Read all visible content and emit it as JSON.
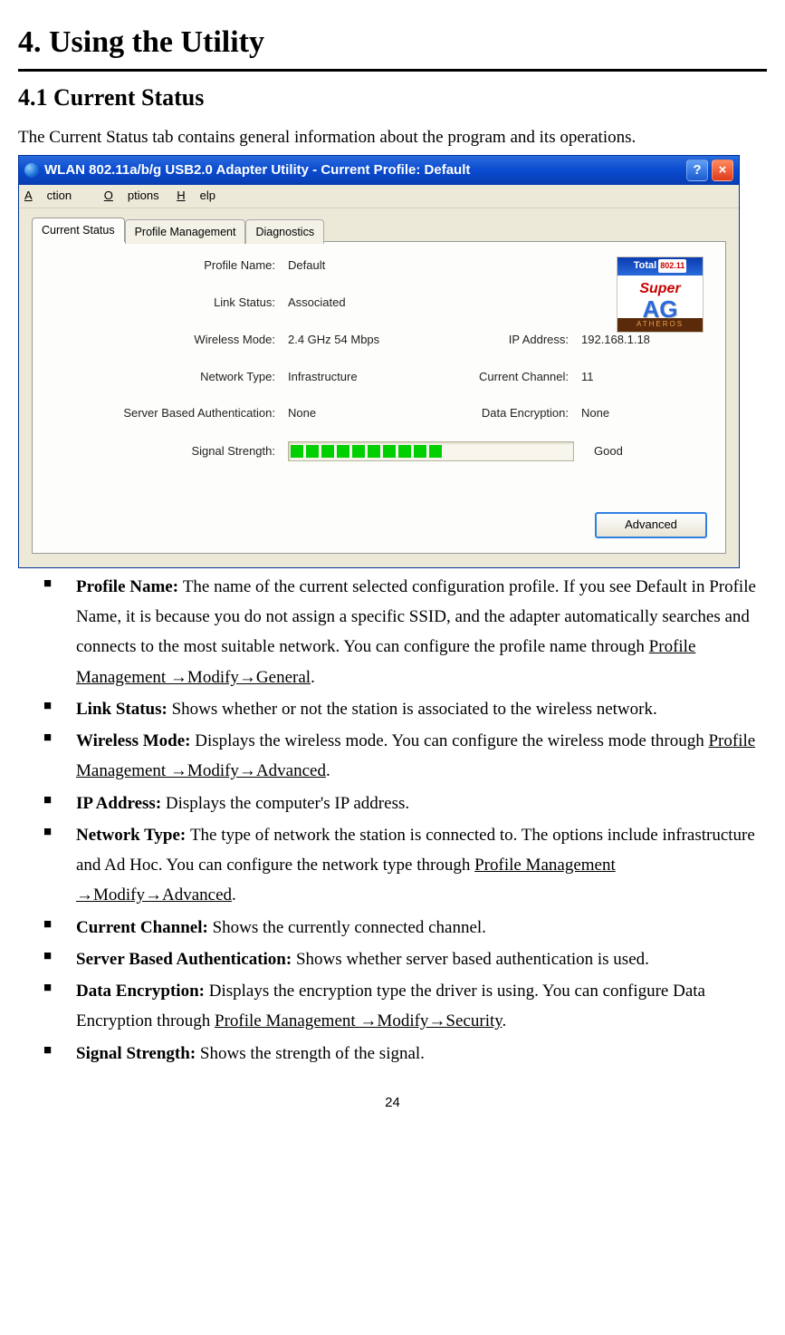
{
  "h1": "4. Using the Utility",
  "h2": "4.1 Current Status",
  "intro": "The Current Status tab contains general information about the program and its operations.",
  "window": {
    "title": "WLAN 802.11a/b/g USB2.0 Adapter Utility - Current Profile: Default",
    "help_btn": "?",
    "close_btn": "×",
    "menu": {
      "action": "Action",
      "options": "Options",
      "help": "Help"
    },
    "tabs": {
      "current": "Current Status",
      "profile": "Profile Management",
      "diag": "Diagnostics"
    },
    "logo": {
      "top1": "Total",
      "top2": "802.11",
      "mid": "Super",
      "ag": "AG",
      "bot": "ATHEROS"
    },
    "labels": {
      "profile_name": "Profile Name:",
      "link_status": "Link Status:",
      "wireless_mode": "Wireless Mode:",
      "ip_address": "IP Address:",
      "network_type": "Network Type:",
      "current_channel": "Current Channel:",
      "server_auth": "Server Based Authentication:",
      "data_encryption": "Data Encryption:",
      "signal_strength": "Signal Strength:"
    },
    "values": {
      "profile_name": "Default",
      "link_status": "Associated",
      "wireless_mode": "2.4 GHz 54 Mbps",
      "ip_address": "192.168.1.18",
      "network_type": "Infrastructure",
      "current_channel": "11",
      "server_auth": "None",
      "data_encryption": "None",
      "signal_strength_text": "Good"
    },
    "advanced_btn": "Advanced"
  },
  "bullets": {
    "b1": {
      "term": "Profile Name: ",
      "text1": "The name of the current selected configuration profile. If you see Default in Profile Name, it is because you do not assign a specific SSID, and the adapter automatically searches and connects to the most suitable network. You can configure the profile name through ",
      "link": "Profile Management →Modify→General",
      "text2": "."
    },
    "b2": {
      "term": "Link Status: ",
      "text": "Shows whether or not the station is associated to the wireless network."
    },
    "b3": {
      "term": "Wireless Mode: ",
      "text1": "Displays the wireless mode. You can configure the wireless mode through ",
      "link": "Profile Management →Modify→Advanced",
      "text2": "."
    },
    "b4": {
      "term": "IP Address: ",
      "text": "Displays the computer's IP address."
    },
    "b5": {
      "term": "Network Type: ",
      "text1": "The type of network the station is connected to. The options include infrastructure and Ad Hoc. You can configure the network type through ",
      "link": "Profile Management →Modify→Advanced",
      "text2": "."
    },
    "b6": {
      "term": "Current Channel: ",
      "text": "Shows the currently connected channel."
    },
    "b7": {
      "term": "Server Based Authentication: ",
      "text": "Shows whether server based authentication is used."
    },
    "b8": {
      "term": "Data Encryption: ",
      "text1": "Displays the encryption type the driver is using. You can configure Data Encryption through ",
      "link": "Profile Management →Modify→Security",
      "text2": "."
    },
    "b9": {
      "term": "Signal Strength: ",
      "text": "Shows the strength of the signal."
    }
  },
  "pagenum": "24"
}
